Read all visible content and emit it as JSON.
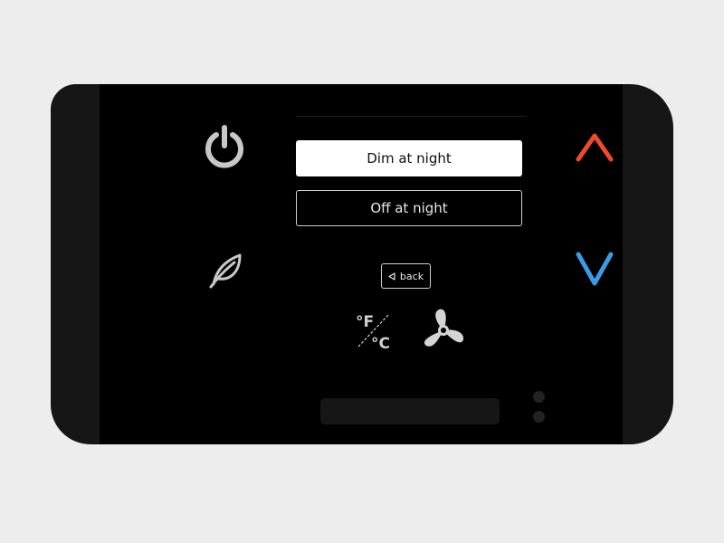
{
  "options": {
    "selected_label": "Dim at night",
    "unselected_label": "Off at night"
  },
  "back_label": "back",
  "units": {
    "fahrenheit": "°F",
    "celsius": "°C"
  },
  "icons": {
    "power": "power-icon",
    "eco": "leaf-icon",
    "up": "arrow-up-icon",
    "down": "arrow-down-icon",
    "units": "temperature-units-icon",
    "fan": "fan-icon"
  },
  "colors": {
    "up_arrow": "#f04a2a",
    "down_arrow": "#3a9be6",
    "icon_gray": "#c8c8c8"
  }
}
